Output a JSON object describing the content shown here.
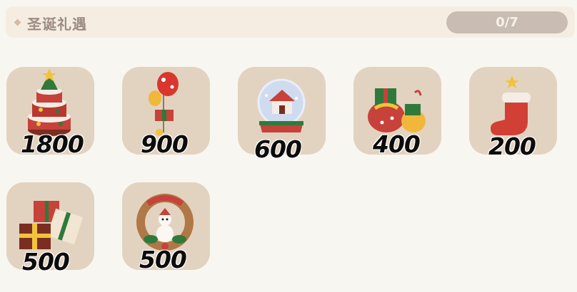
{
  "header": {
    "title": "圣诞礼遇",
    "progress_text": "0/7"
  },
  "items": [
    {
      "name": "christmas-tree-cake",
      "price": "1800"
    },
    {
      "name": "balloon-bouquet",
      "price": "900"
    },
    {
      "name": "snow-globe",
      "price": "600"
    },
    {
      "name": "gift-sacks",
      "price": "400"
    },
    {
      "name": "christmas-stocking",
      "price": "200"
    },
    {
      "name": "gift-box-stack",
      "price": "500"
    },
    {
      "name": "snowman-wreath",
      "price": "500"
    }
  ]
}
